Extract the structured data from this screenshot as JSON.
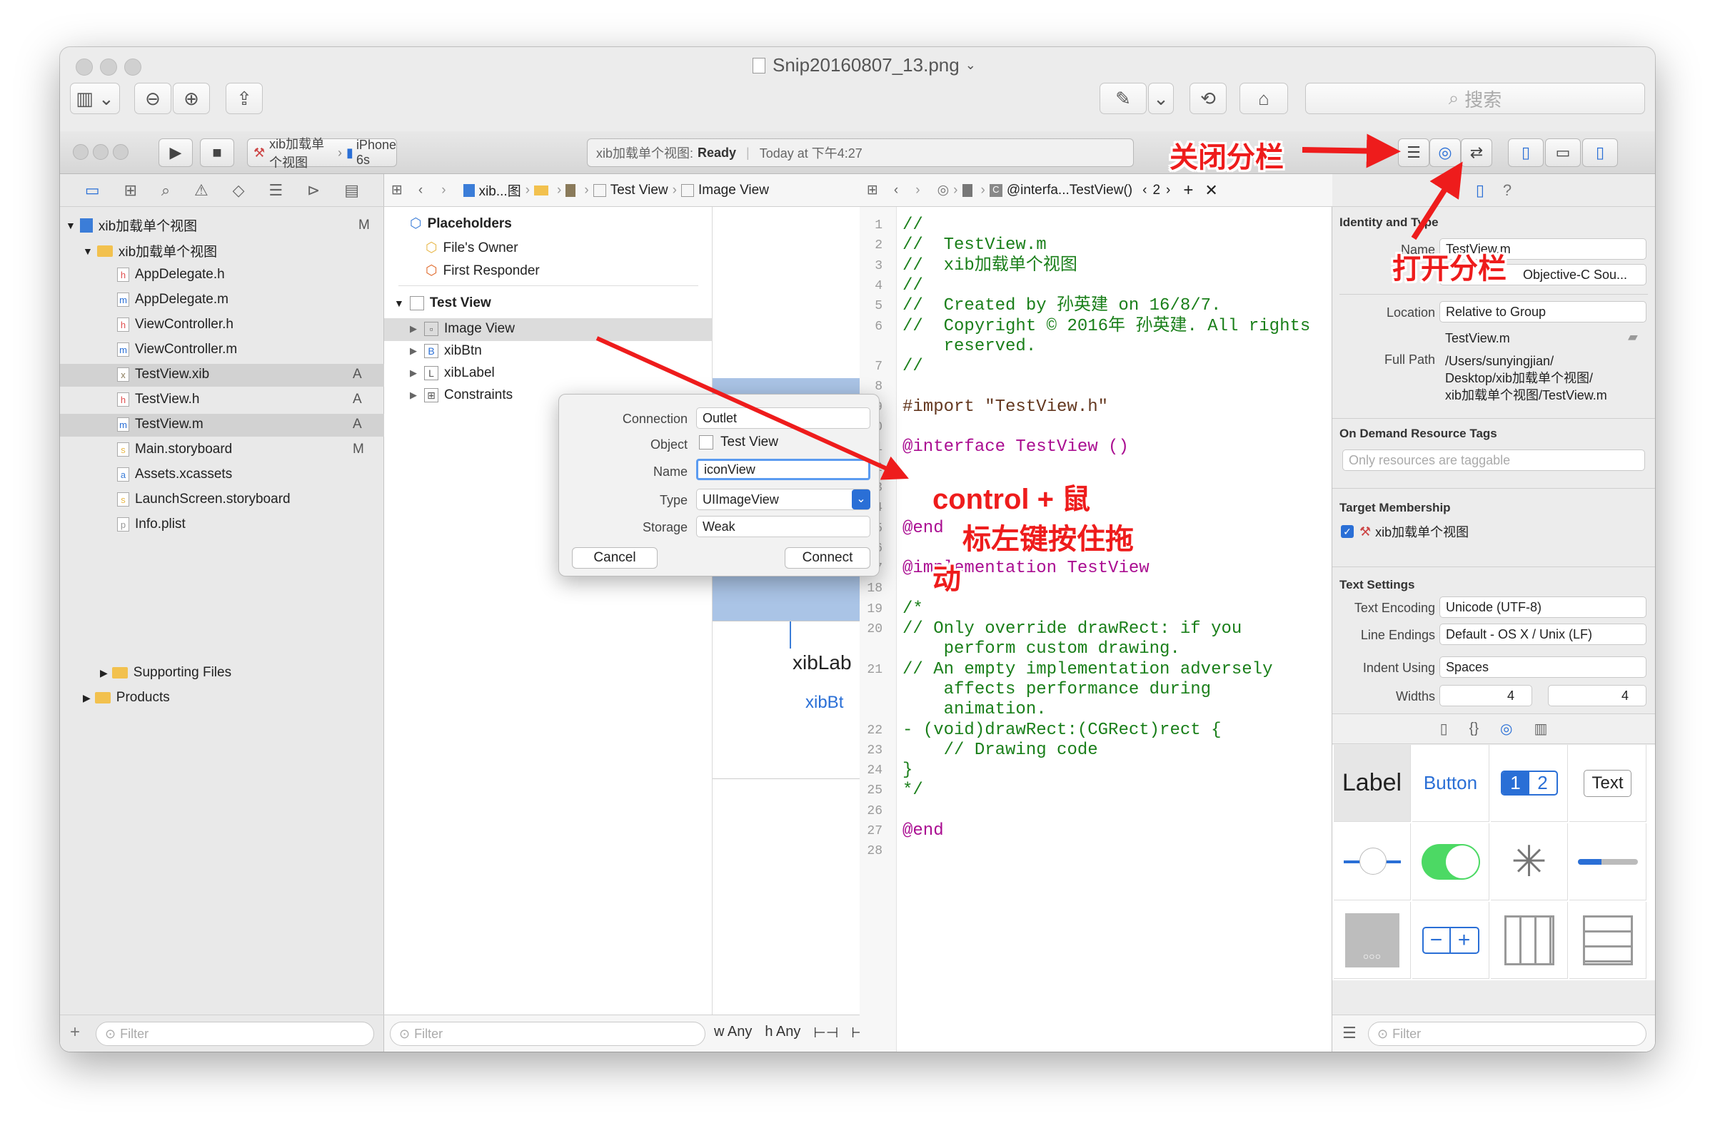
{
  "preview_window": {
    "title": "Snip20160807_13.png",
    "search_placeholder": "搜索"
  },
  "xcode": {
    "scheme": "xib加载单个视图",
    "device": "iPhone 6s",
    "status_project": "xib加载单个视图:",
    "status_state": "Ready",
    "status_time": "Today at 下午4:27"
  },
  "navigator": {
    "project": "xib加载单个视图",
    "project_badge": "M",
    "group": "xib加载单个视图",
    "files": [
      {
        "name": "AppDelegate.h",
        "icon": "h",
        "badge": ""
      },
      {
        "name": "AppDelegate.m",
        "icon": "m",
        "badge": ""
      },
      {
        "name": "ViewController.h",
        "icon": "h",
        "badge": ""
      },
      {
        "name": "ViewController.m",
        "icon": "m",
        "badge": ""
      },
      {
        "name": "TestView.xib",
        "icon": "x",
        "badge": "A"
      },
      {
        "name": "TestView.h",
        "icon": "h",
        "badge": "A"
      },
      {
        "name": "TestView.m",
        "icon": "m",
        "badge": "A"
      },
      {
        "name": "Main.storyboard",
        "icon": "s",
        "badge": "M"
      },
      {
        "name": "Assets.xcassets",
        "icon": "a",
        "badge": ""
      },
      {
        "name": "LaunchScreen.storyboard",
        "icon": "s",
        "badge": ""
      },
      {
        "name": "Info.plist",
        "icon": "p",
        "badge": ""
      }
    ],
    "supporting_files": "Supporting Files",
    "products": "Products",
    "filter_placeholder": "Filter"
  },
  "ib_jumpbar": {
    "crumb1": "xib...图",
    "crumb2": "Test View",
    "crumb3": "Image View"
  },
  "outline": {
    "placeholders": "Placeholders",
    "files_owner": "File's Owner",
    "first_responder": "First Responder",
    "test_view": "Test View",
    "children": [
      "Image View",
      "xibBtn",
      "xibLabel",
      "Constraints"
    ],
    "filter_placeholder": "Filter"
  },
  "canvas": {
    "label_text": "xibLab",
    "button_text": "xibBt",
    "bottom_labels": [
      "w Any",
      "h Any"
    ]
  },
  "connection_popup": {
    "connection_label": "Connection",
    "connection_value": "Outlet",
    "object_label": "Object",
    "object_value": "Test View",
    "name_label": "Name",
    "name_value": "iconView",
    "type_label": "Type",
    "type_value": "UIImageView",
    "storage_label": "Storage",
    "storage_value": "Weak",
    "cancel": "Cancel",
    "connect": "Connect"
  },
  "editor_jumpbar": {
    "crumb": "@interfa...TestView()",
    "counter": "2"
  },
  "code_lines": [
    {
      "n": "1",
      "text": "//",
      "cls": "c-green"
    },
    {
      "n": "2",
      "text": "//  TestView.m",
      "cls": "c-green"
    },
    {
      "n": "3",
      "text": "//  xib加载单个视图",
      "cls": "c-green"
    },
    {
      "n": "4",
      "text": "//",
      "cls": "c-green"
    },
    {
      "n": "5",
      "text": "//  Created by 孙英建 on 16/8/7.",
      "cls": "c-green"
    },
    {
      "n": "6",
      "text": "//  Copyright © 2016年 孙英建. All rights",
      "cls": "c-green"
    },
    {
      "n": "",
      "text": "    reserved.",
      "cls": "c-green"
    },
    {
      "n": "7",
      "text": "//",
      "cls": "c-green"
    },
    {
      "n": "8",
      "text": "",
      "cls": ""
    },
    {
      "n": "9",
      "text": "#import \"TestView.h\"",
      "cls": "c-brown"
    },
    {
      "n": "10",
      "text": "",
      "cls": ""
    },
    {
      "n": "11",
      "text": "@interface TestView ()",
      "cls": "c-purple"
    },
    {
      "n": "12",
      "text": "",
      "cls": ""
    },
    {
      "n": "13",
      "text": "",
      "cls": ""
    },
    {
      "n": "14",
      "text": "",
      "cls": ""
    },
    {
      "n": "15",
      "text": "@end",
      "cls": "c-purple"
    },
    {
      "n": "16",
      "text": "",
      "cls": ""
    },
    {
      "n": "17",
      "text": "@implementation TestView",
      "cls": "c-purple"
    },
    {
      "n": "18",
      "text": "",
      "cls": ""
    },
    {
      "n": "19",
      "text": "/*",
      "cls": "c-green"
    },
    {
      "n": "20",
      "text": "// Only override drawRect: if you",
      "cls": "c-green"
    },
    {
      "n": "",
      "text": "    perform custom drawing.",
      "cls": "c-green"
    },
    {
      "n": "21",
      "text": "// An empty implementation adversely",
      "cls": "c-green"
    },
    {
      "n": "",
      "text": "    affects performance during",
      "cls": "c-green"
    },
    {
      "n": "",
      "text": "    animation.",
      "cls": "c-green"
    },
    {
      "n": "22",
      "text": "- (void)drawRect:(CGRect)rect {",
      "cls": "c-green"
    },
    {
      "n": "23",
      "text": "    // Drawing code",
      "cls": "c-green"
    },
    {
      "n": "24",
      "text": "}",
      "cls": "c-green"
    },
    {
      "n": "25",
      "text": "*/",
      "cls": "c-green"
    },
    {
      "n": "26",
      "text": "",
      "cls": ""
    },
    {
      "n": "27",
      "text": "@end",
      "cls": "c-purple"
    },
    {
      "n": "28",
      "text": "",
      "cls": ""
    }
  ],
  "inspector": {
    "identity_type": "Identity and Type",
    "name_label": "Name",
    "name_value": "TestView.m",
    "type_value": "Objective-C Sou...",
    "location_label": "Location",
    "location_value": "Relative to Group",
    "location_file": "TestView.m",
    "fullpath_label": "Full Path",
    "fullpath_lines": [
      "/Users/sunyingjian/",
      "Desktop/xib加载单个视图/",
      "xib加载单个视图/TestView.m"
    ],
    "on_demand": "On Demand Resource Tags",
    "only_taggable": "Only resources are taggable",
    "target_membership": "Target Membership",
    "target_name": "xib加载单个视图",
    "text_settings": "Text Settings",
    "text_encoding_label": "Text Encoding",
    "text_encoding_value": "Unicode (UTF-8)",
    "line_endings_label": "Line Endings",
    "line_endings_value": "Default - OS X / Unix (LF)",
    "indent_using_label": "Indent Using",
    "indent_using_value": "Spaces",
    "widths_label": "Widths",
    "widths_tab": "4",
    "widths_indent": "4"
  },
  "library": {
    "label": "Label",
    "button": "Button",
    "seg1": "1",
    "seg2": "2",
    "text": "Text",
    "filter_placeholder": "Filter"
  },
  "annotations": {
    "close_split": "关闭分栏",
    "open_split": "打开分栏",
    "drag_line1": "control + 鼠",
    "drag_line2": "标左键按住拖",
    "drag_line3": "动"
  },
  "colors": {
    "annotation_red": "#ee1c1c",
    "selection_blue": "#1a73e8",
    "code_green": "#1a7f1a",
    "code_purple": "#aa0d91"
  }
}
